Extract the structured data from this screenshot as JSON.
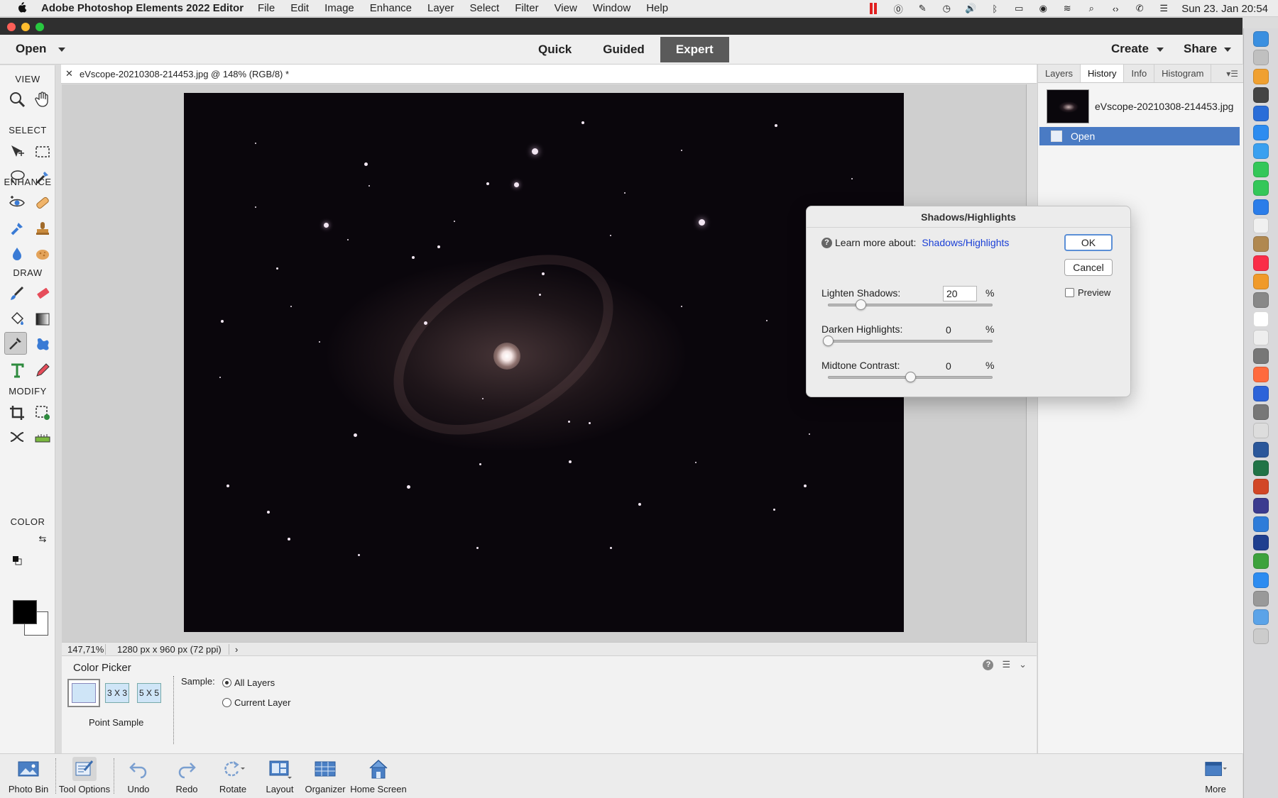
{
  "menubar": {
    "app": "Adobe Photoshop Elements 2022 Editor",
    "items": [
      "File",
      "Edit",
      "Image",
      "Enhance",
      "Layer",
      "Select",
      "Filter",
      "View",
      "Window",
      "Help"
    ],
    "clock": "Sun 23. Jan  20:54"
  },
  "topbar": {
    "open": "Open",
    "modes": [
      "Quick",
      "Guided",
      "Expert"
    ],
    "active_mode": "Expert",
    "create": "Create",
    "share": "Share"
  },
  "toolbar": {
    "sections": [
      "VIEW",
      "SELECT",
      "ENHANCE",
      "DRAW",
      "MODIFY",
      "COLOR"
    ]
  },
  "document": {
    "tab_title": "eVscope-20210308-214453.jpg @ 148% (RGB/8) *",
    "zoom": "147,71%",
    "dimensions": "1280 px x 960 px (72 ppi)"
  },
  "tool_options": {
    "title": "Color Picker",
    "sizes": [
      "3 X 3",
      "5 X 5"
    ],
    "point_sample": "Point Sample",
    "sample_label": "Sample:",
    "radio_all": "All Layers",
    "radio_current": "Current Layer",
    "selected_radio": "All Layers"
  },
  "right_panel": {
    "tabs": [
      "Layers",
      "History",
      "Info",
      "Histogram"
    ],
    "active_tab": "History",
    "history": [
      {
        "label": "eVscope-20210308-214453.jpg"
      },
      {
        "label": "Open"
      }
    ]
  },
  "dialog": {
    "title": "Shadows/Highlights",
    "learn_prefix": "Learn more about:",
    "learn_link": "Shadows/Highlights",
    "ok": "OK",
    "cancel": "Cancel",
    "preview": "Preview",
    "preview_checked": false,
    "params": [
      {
        "label": "Lighten Shadows:",
        "value": "20",
        "unit": "%",
        "level": 0.2
      },
      {
        "label": "Darken Highlights:",
        "value": "0",
        "unit": "%",
        "level": 0.0
      },
      {
        "label": "Midtone Contrast:",
        "value": "0",
        "unit": "%",
        "level": 0.5
      }
    ]
  },
  "bottombar": {
    "items": [
      "Photo Bin",
      "Tool Options",
      "Undo",
      "Redo",
      "Rotate",
      "Layout",
      "Organizer",
      "Home Screen"
    ],
    "more": "More"
  }
}
